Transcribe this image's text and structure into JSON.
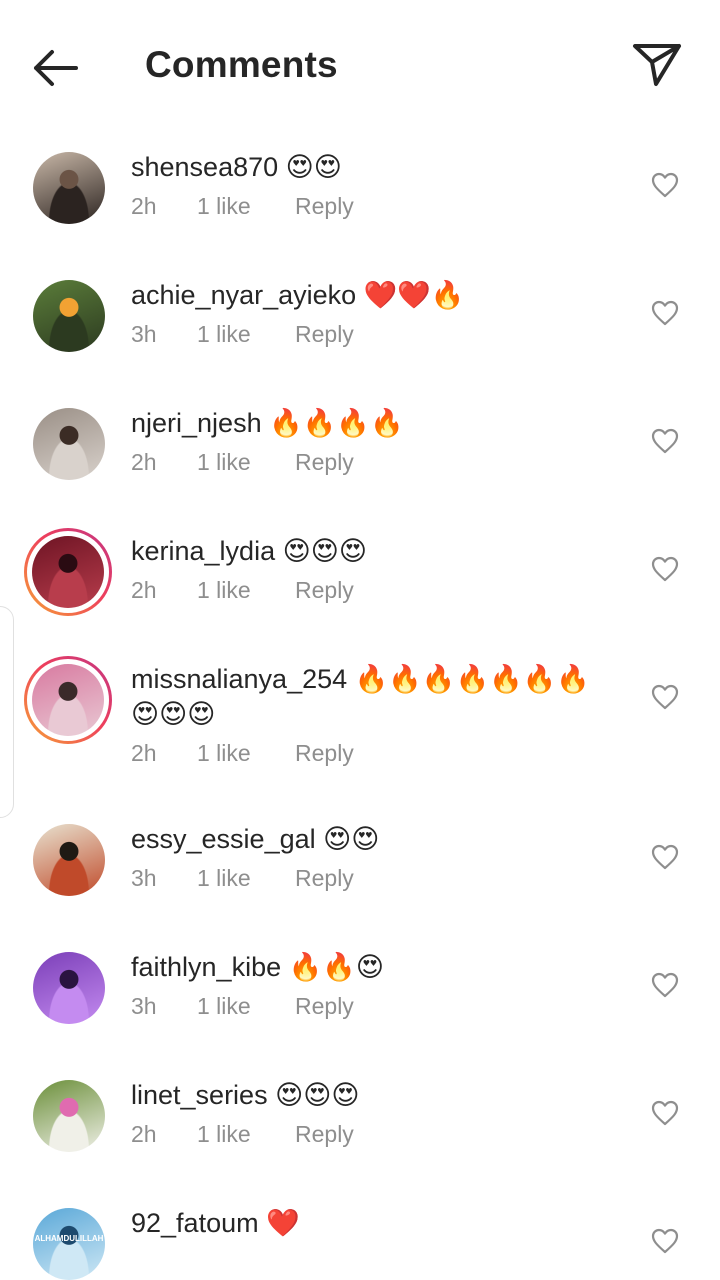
{
  "header": {
    "title": "Comments"
  },
  "comments": [
    {
      "username": "shensea870",
      "emoji": "😍😍",
      "time": "2h",
      "likes": "1 like",
      "reply": "Reply",
      "story": false,
      "colors": [
        "#c9b8a8",
        "#6b5446",
        "#2b2320"
      ]
    },
    {
      "username": "achie_nyar_ayieko",
      "emoji": "❤️❤️🔥",
      "time": "3h",
      "likes": "1 like",
      "reply": "Reply",
      "story": false,
      "colors": [
        "#5b7d3a",
        "#f2a233",
        "#2c3a20"
      ]
    },
    {
      "username": "njeri_njesh",
      "emoji": "🔥🔥🔥🔥",
      "time": "2h",
      "likes": "1 like",
      "reply": "Reply",
      "story": false,
      "colors": [
        "#9a8f86",
        "#3b2c25",
        "#d9d2cc"
      ]
    },
    {
      "username": "kerina_lydia",
      "emoji": "😍😍😍",
      "time": "2h",
      "likes": "1 like",
      "reply": "Reply",
      "story": true,
      "colors": [
        "#6e1424",
        "#2a0b12",
        "#b83d4c"
      ]
    },
    {
      "username": "missnalianya_254",
      "emoji": "🔥🔥🔥🔥🔥🔥🔥",
      "emoji2": "😍😍😍",
      "time": "2h",
      "likes": "1 like",
      "reply": "Reply",
      "story": true,
      "colors": [
        "#d87aa0",
        "#3a2a2a",
        "#e9c9d4"
      ]
    },
    {
      "username": "essy_essie_gal",
      "emoji": "😍😍",
      "time": "3h",
      "likes": "1 like",
      "reply": "Reply",
      "story": false,
      "colors": [
        "#e8e2d0",
        "#1f1a14",
        "#c04a2a"
      ]
    },
    {
      "username": "faithlyn_kibe",
      "emoji": "🔥🔥😍",
      "time": "3h",
      "likes": "1 like",
      "reply": "Reply",
      "story": false,
      "colors": [
        "#7b3fb8",
        "#2a1440",
        "#c48bf0"
      ]
    },
    {
      "username": "linet_series",
      "emoji": "😍😍😍",
      "time": "2h",
      "likes": "1 like",
      "reply": "Reply",
      "story": false,
      "colors": [
        "#6b8f3a",
        "#e06bb0",
        "#f0f0e8"
      ]
    },
    {
      "username": "92_fatoum",
      "emoji": "❤️",
      "time": "",
      "likes": "",
      "reply": "",
      "story": false,
      "avatar_text": "ALHAMDULILLAH",
      "colors": [
        "#5aa8d8",
        "#1d4a6e",
        "#cfe8f5"
      ]
    }
  ]
}
